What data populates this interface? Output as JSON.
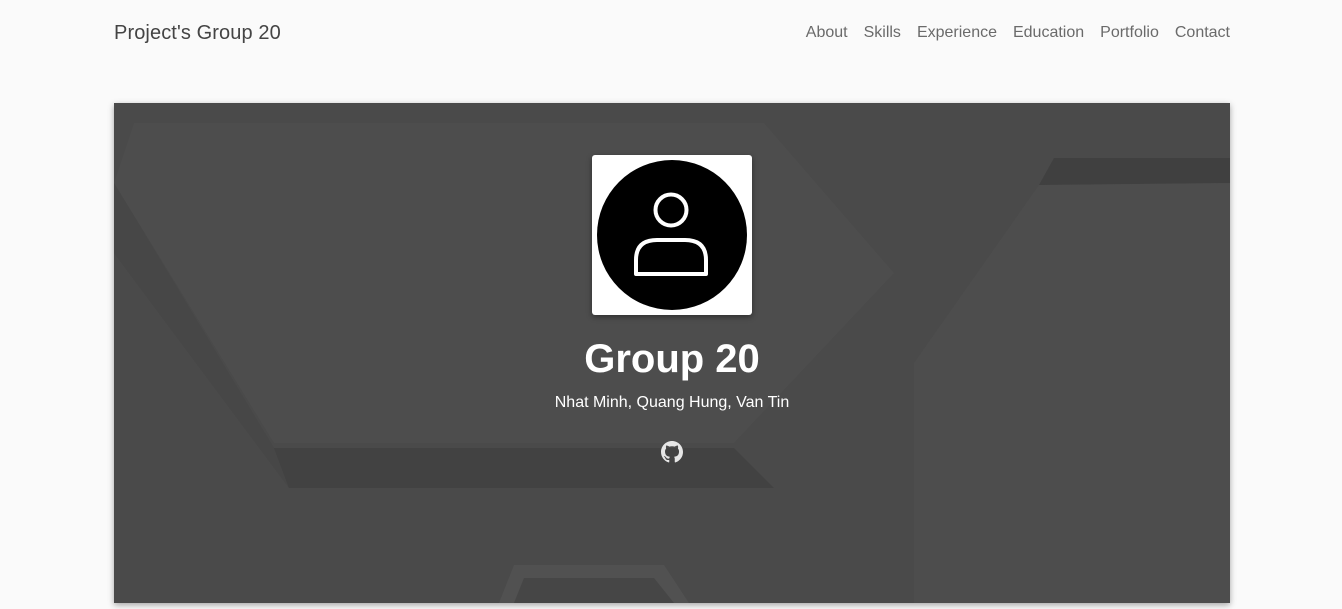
{
  "nav": {
    "brand": "Project's Group 20",
    "links": [
      "About",
      "Skills",
      "Experience",
      "Education",
      "Portfolio",
      "Contact"
    ]
  },
  "hero": {
    "title": "Group 20",
    "subtitle": "Nhat Minh, Quang Hung, Van Tin",
    "avatar_icon": "user-icon",
    "social_icon": "github-icon"
  },
  "colors": {
    "page_bg": "#fafafa",
    "hero_bg": "#4a4a4a",
    "text_light": "#ffffff",
    "nav_text": "#6a6a6a",
    "brand_text": "#444444"
  }
}
